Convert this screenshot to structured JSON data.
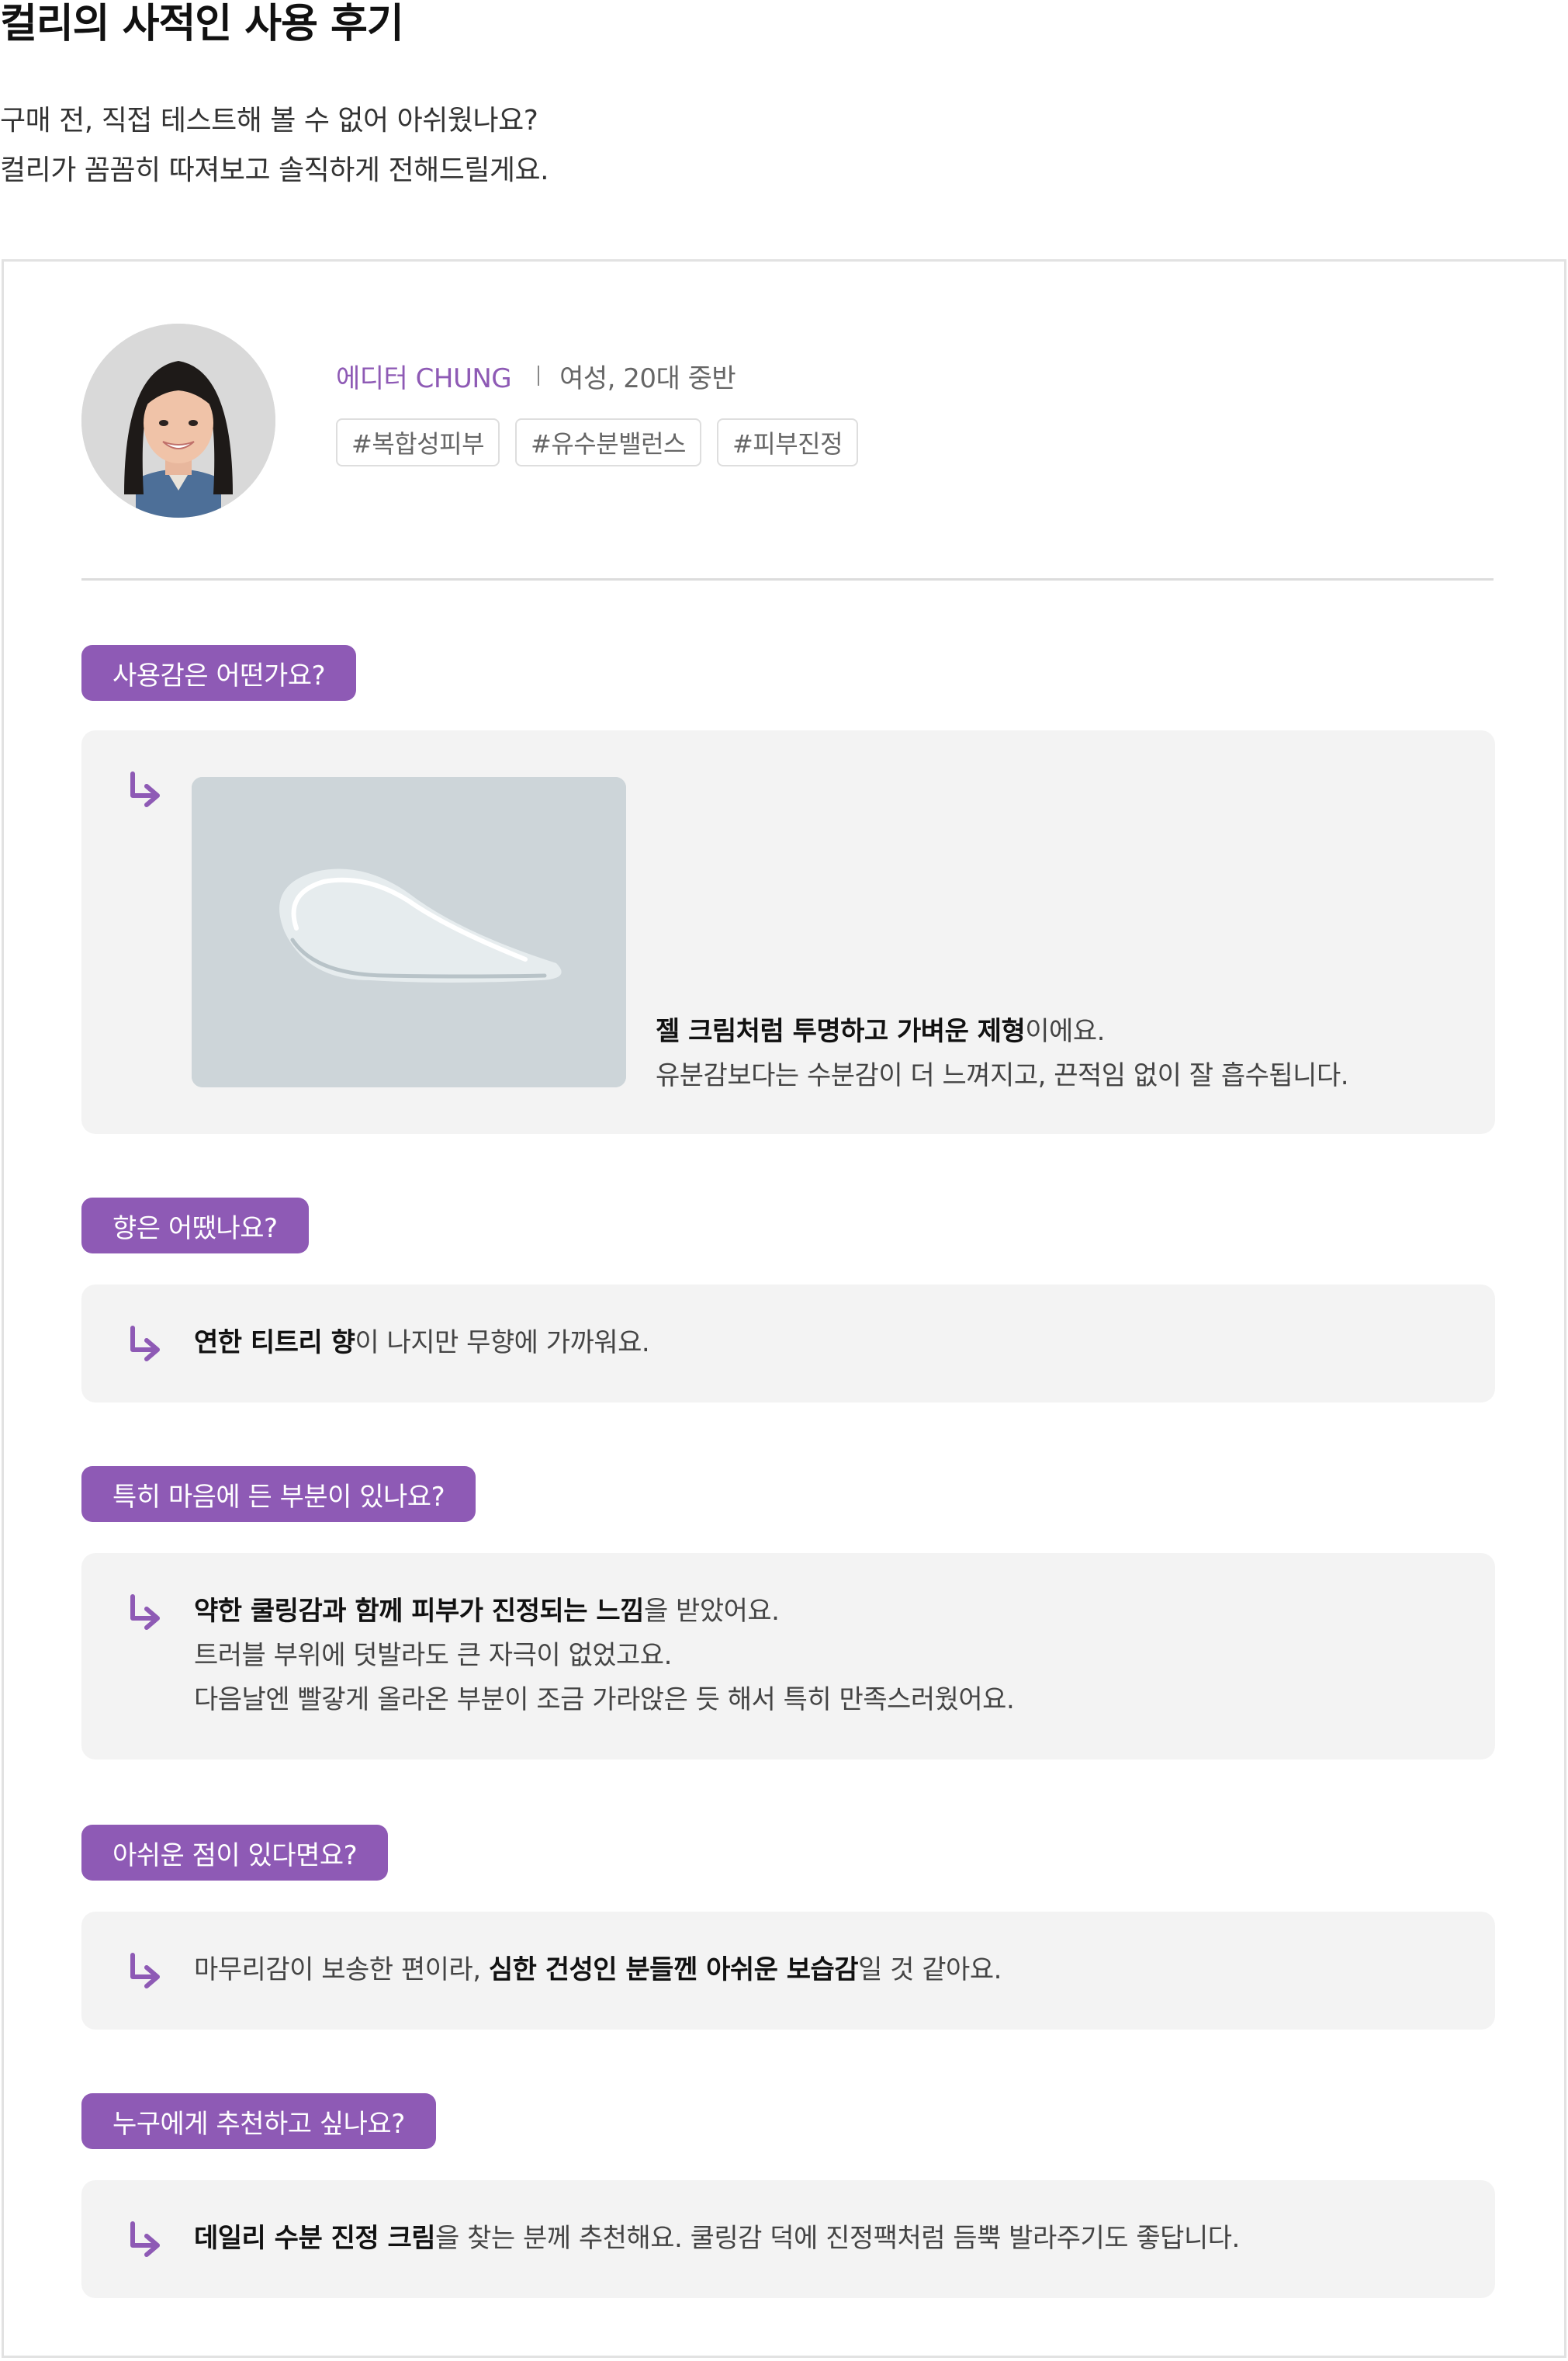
{
  "header": {
    "title": "컬리의 사적인 사용 후기",
    "intro_line1": "구매 전, 직접 테스트해 볼 수 없어 아쉬웠나요?",
    "intro_line2": "컬리가 꼼꼼히 따져보고 솔직하게 전해드릴게요."
  },
  "profile": {
    "editor_label": "에디터 CHUNG",
    "meta": "여성, 20대 중반",
    "tags": [
      "#복합성피부",
      "#유수분밸런스",
      "#피부진정"
    ]
  },
  "qa": [
    {
      "question": "사용감은 어떤가요?",
      "line1_bold": "젤 크림처럼 투명하고 가벼운 제형",
      "line1_rest": "이에요.",
      "line2": "유분감보다는 수분감이 더 느껴지고, 끈적임 없이 잘 흡수됩니다."
    },
    {
      "question": "향은 어땠나요?",
      "line1_bold": "연한 티트리 향",
      "line1_rest": "이 나지만 무향에 가까워요."
    },
    {
      "question": "특히 마음에 든 부분이 있나요?",
      "line1_bold": "약한 쿨링감과 함께 피부가 진정되는 느낌",
      "line1_rest": "을 받았어요.",
      "line2": "트러블 부위에 덧발라도 큰 자극이 없었고요.",
      "line3": "다음날엔 빨갛게 올라온 부분이 조금 가라앉은 듯 해서 특히 만족스러웠어요."
    },
    {
      "question": "아쉬운 점이 있다면요?",
      "line1_pre": "마무리감이 보송한 편이라, ",
      "line1_bold": "심한 건성인 분들껜 아쉬운 보습감",
      "line1_rest": "일 것 같아요."
    },
    {
      "question": "누구에게 추천하고 싶나요?",
      "line1_bold": "데일리 수분 진정 크림",
      "line1_rest": "을 찾는 분께 추천해요. 쿨링감 덕에 진정팩처럼 듬뿍 발라주기도 좋답니다."
    }
  ],
  "icons": {
    "answer_arrow": "return-arrow-icon",
    "avatar": "editor-portrait-image",
    "photo": "cream-texture-swatch-image"
  },
  "colors": {
    "accent": "#8e5ab5",
    "answer_bg": "#f3f3f3",
    "text": "#333333"
  }
}
